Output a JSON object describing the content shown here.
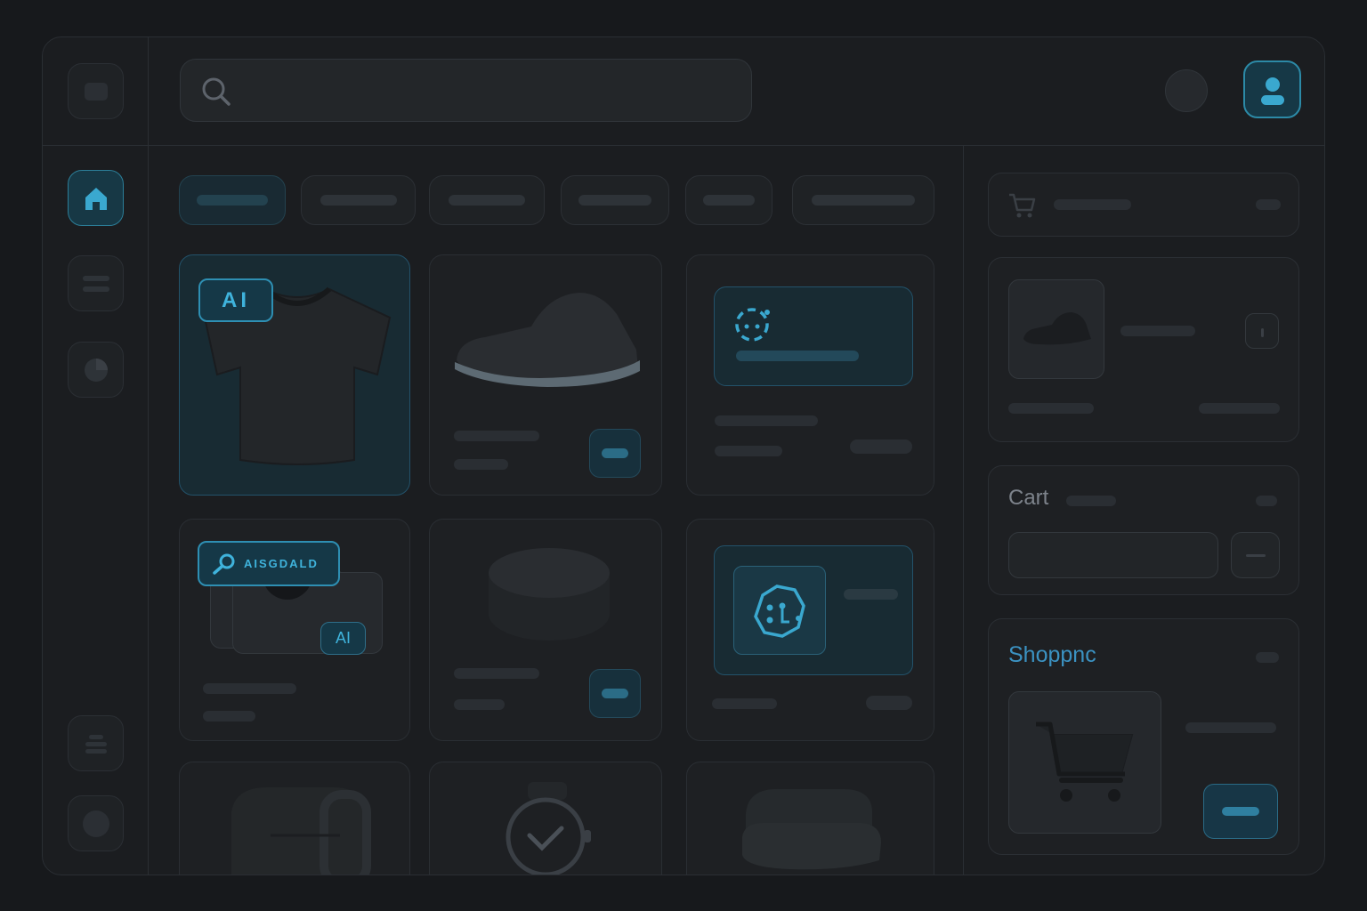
{
  "app": {
    "title": ""
  },
  "search": {
    "placeholder": ""
  },
  "sidebar": {
    "items": [
      {
        "icon": "home-icon",
        "active": true
      },
      {
        "icon": "list-icon",
        "active": false
      },
      {
        "icon": "pie-chart-icon",
        "active": false
      },
      {
        "icon": "stack-icon",
        "active": false
      },
      {
        "icon": "circle-icon",
        "active": false
      }
    ]
  },
  "header": {
    "avatar_icon": "user-icon"
  },
  "filters": {
    "active_index": 0,
    "count": 6
  },
  "products": {
    "ai_badge": "AI",
    "ai_search_badge": "AISGDALD",
    "ai_small_badge": "AI"
  },
  "cart": {
    "title": "Cart"
  },
  "shopping": {
    "title": "Shoppnc"
  },
  "colors": {
    "accent": "#2c8aa7",
    "accent_text": "#3fb3dc",
    "background": "#17191c",
    "panel": "#1b1d20"
  }
}
